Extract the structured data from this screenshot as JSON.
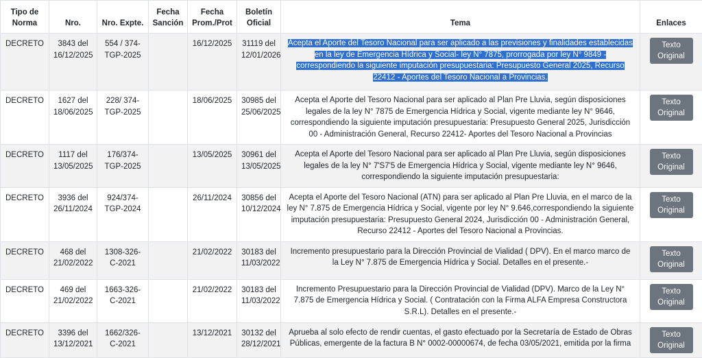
{
  "columns": [
    "Tipo de Norma",
    "Nro.",
    "Nro. Expte.",
    "Fecha Sanción",
    "Fecha Prom./Prot",
    "Boletín Oficial",
    "Tema",
    "Enlaces"
  ],
  "rows": [
    {
      "tipo": "DECRETO",
      "nro": "3843 del 16/12/2025",
      "expte": "554 / 374-TGP-2025",
      "sancion": "",
      "prom": "16/12/2025",
      "boletin": "31119 del 12/01/2026",
      "tema": "Acepta el Aporte del Tesoro Nacional para ser aplicado a las previsiones y finalidades establecidas en la ley de Emergencia Hídrica y Social- ley N° 7875, prorrogada por ley N° 9849 - correspondiendo la siguiente imputación presupuestaria: Presupuesto General 2025, Recurso 22412 - Aportes del Tesoro Nacional a Provincias.",
      "selected": true,
      "link": "Texto Original"
    },
    {
      "tipo": "DECRETO",
      "nro": "1627 del 18/06/2025",
      "expte": "228/ 374-TGP-2025",
      "sancion": "",
      "prom": "18/06/2025",
      "boletin": "30985 del 25/06/2025",
      "tema": "Acepta el Aporte del Tesoro Nacional para ser aplicado al Plan Pre Lluvia, según disposiciones legales de la ley N° 7875 de Emergencia Hídrica y Social, vigente mediante ley N° 9646, correspondiendo la siguiente imputación presupuestaria: Presupuesto General 2025, Jurisdicción 00 - Administración General, Recurso 22412- Aportes del Tesoro Nacional a Provincias",
      "selected": false,
      "link": "Texto Original"
    },
    {
      "tipo": "DECRETO",
      "nro": "1117 del 13/05/2025",
      "expte": "176/374-TGP-2025",
      "sancion": "",
      "prom": "13/05/2025",
      "boletin": "30961 del 13/05/2025",
      "tema": "Acepta el Aporte del Tesoro Nacional para ser aplicado al Plan Pre Lluvia, según disposiciones legales de la ley N° 7'S7'5 de Emergencia Hídrica y Social, vigente mediante ley N° 9646, correspondiendo la siguiente imputación presupuestaria:",
      "selected": false,
      "link": "Texto Original"
    },
    {
      "tipo": "DECRETO",
      "nro": "3936 del 26/11/2024",
      "expte": "924/374-TGP-2024",
      "sancion": "",
      "prom": "26/11/2024",
      "boletin": "30856 del 10/12/2024",
      "tema": "Acepta el Aporte del Tesoro Nacional (ATN) para ser aplicado al Plan Pre Lluvia, en el marco de la ley N° 7.875 de Emergencia Hídrica y Social, vigente por ley N° 9.646,correspondiendo la siguiente imputación presupuestaria: Presupuesto General 2024, Jurisdicción 00 - Administración General, Recurso 22412 - Aportes del Tesoro Nacional a Provincias.",
      "selected": false,
      "link": "Texto Original"
    },
    {
      "tipo": "DECRETO",
      "nro": "468 del 21/02/2022",
      "expte": "1308-326-C-2021",
      "sancion": "",
      "prom": "21/02/2022",
      "boletin": "30183 del 11/03/2022",
      "tema": "Incremento presupuestario para la Dirección Provincial de Vialidad ( DPV). En el marco marco de la Ley N° 7.875 de Emergencia Hídrica y Social. Detalles en el presente.-",
      "selected": false,
      "link": "Texto Original"
    },
    {
      "tipo": "DECRETO",
      "nro": "469 del 21/02/2022",
      "expte": "1663-326-C-2021",
      "sancion": "",
      "prom": "21/02/2022",
      "boletin": "30183 del 11/03/2022",
      "tema": "Incremento Presupuestario para la Dirección Provincial de Vialidad (DPV). Marco de la Ley N° 7.875 de Emergencia Hídrica y Social. ( Contratación con la Firma ALFA Empresa Constructora S.R.L). Detalles en el presente.-",
      "selected": false,
      "link": "Texto Original"
    },
    {
      "tipo": "DECRETO",
      "nro": "3396 del 13/12/2021",
      "expte": "1662/326-C-2021",
      "sancion": "",
      "prom": "13/12/2021",
      "boletin": "30132 del 28/12/2021",
      "tema": "Aprueba al solo efecto de rendir cuentas, el gasto efectuado por la Secretaría de Estado de Obras Públicas, emergente de la factura B N° 0002-00000674, de fecha 03/05/2021, emitida por la firma",
      "selected": false,
      "link": "Texto Original"
    }
  ]
}
